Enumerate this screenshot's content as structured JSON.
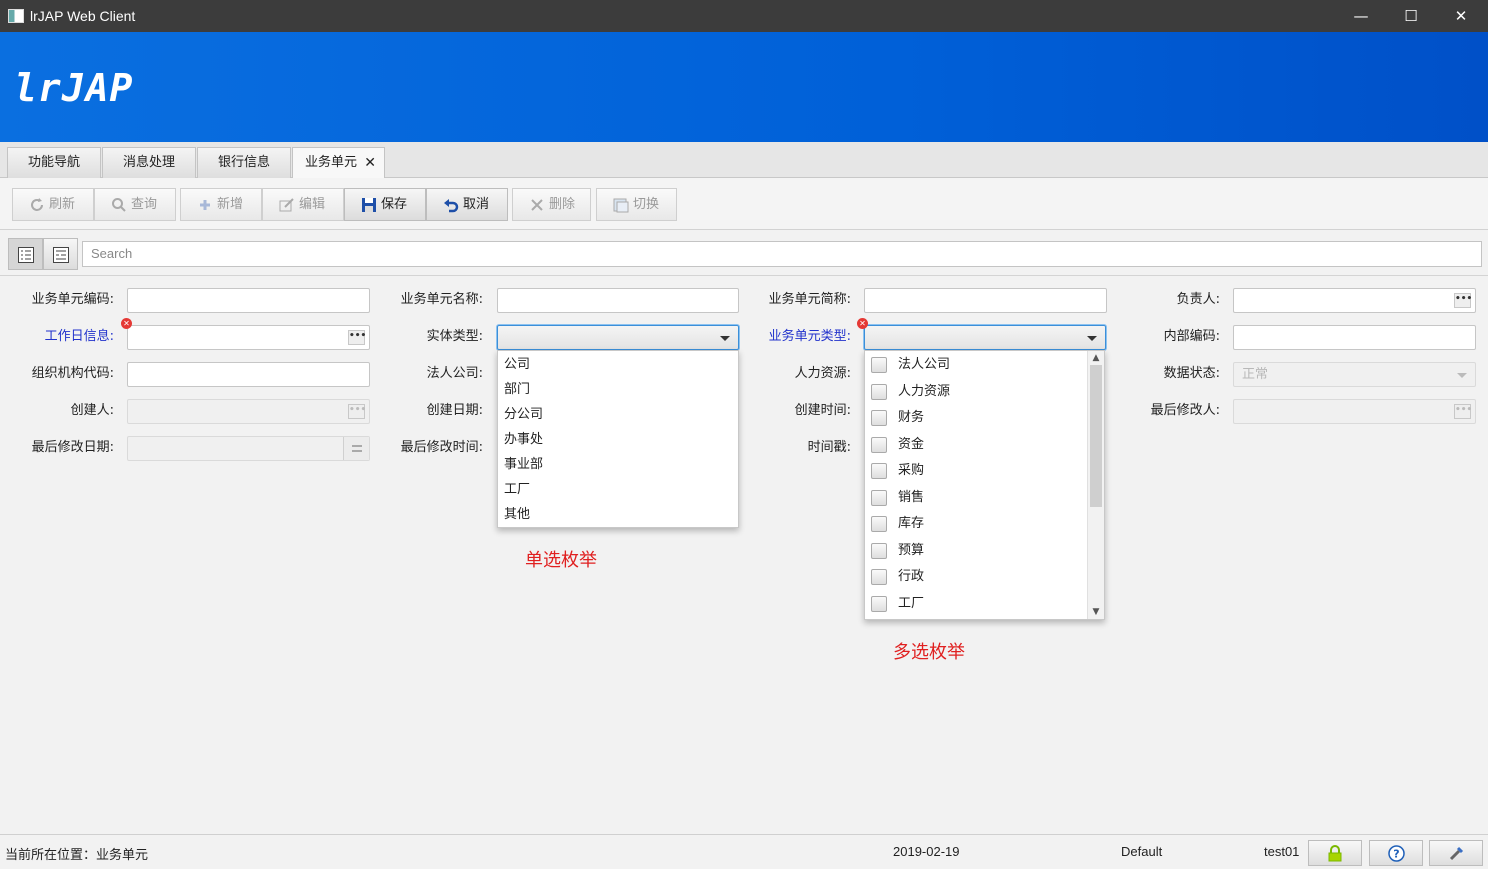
{
  "window": {
    "title": "lrJAP Web Client",
    "minimize": "—",
    "maximize": "☐",
    "close": "✕"
  },
  "banner": {
    "logo": "lrJAP"
  },
  "tabs": [
    {
      "label": "功能导航"
    },
    {
      "label": "消息处理"
    },
    {
      "label": "银行信息"
    },
    {
      "label": "业务单元",
      "close": "✕"
    }
  ],
  "toolbar": {
    "refresh": "刷新",
    "query": "查询",
    "add": "新增",
    "edit": "编辑",
    "save": "保存",
    "cancel": "取消",
    "delete": "删除",
    "switch": "切换"
  },
  "search": {
    "placeholder": "Search"
  },
  "form": {
    "unit_code": "业务单元编码:",
    "unit_name": "业务单元名称:",
    "unit_short": "业务单元简称:",
    "owner": "负责人:",
    "workday": "工作日信息:",
    "entity_type": "实体类型:",
    "unit_type": "业务单元类型:",
    "internal_code": "内部编码:",
    "org_code": "组织机构代码:",
    "legal_company": "法人公司:",
    "hr": "人力资源:",
    "data_status": "数据状态:",
    "data_status_value": "正常",
    "creator": "创建人:",
    "create_date": "创建日期:",
    "create_time": "创建时间:",
    "last_modifier": "最后修改人:",
    "last_modify_date": "最后修改日期:",
    "last_modify_time": "最后修改时间:",
    "timestamp": "时间戳:"
  },
  "single_options": [
    "公司",
    "部门",
    "分公司",
    "办事处",
    "事业部",
    "工厂",
    "其他"
  ],
  "multi_options": [
    "法人公司",
    "人力资源",
    "财务",
    "资金",
    "采购",
    "销售",
    "库存",
    "预算",
    "行政",
    "工厂"
  ],
  "annotations": {
    "single": "单选枚举",
    "multi": "多选枚举"
  },
  "status": {
    "location": "当前所在位置：业务单元",
    "date": "2019-02-19",
    "theme": "Default",
    "user": "test01"
  },
  "colors": {
    "banner": "#0060d8",
    "required_label": "#2233cc",
    "annotation": "#e02020"
  }
}
